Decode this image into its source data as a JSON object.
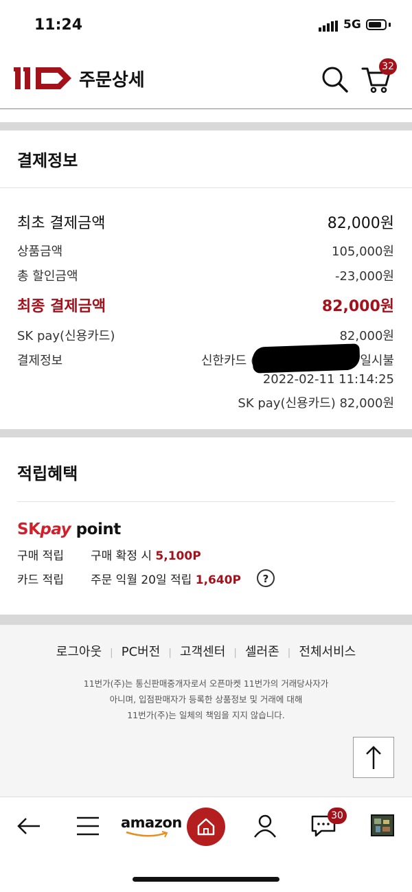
{
  "status": {
    "time": "11:24",
    "network": "5G"
  },
  "header": {
    "title": "주문상세",
    "cart_count": "32"
  },
  "payment": {
    "section_title": "결제정보",
    "initial_label": "최초 결제금액",
    "initial_value": "82,000원",
    "product_label": "상품금액",
    "product_value": "105,000원",
    "discount_label": "총 할인금액",
    "discount_value": "-23,000원",
    "final_label": "최종 결제금액",
    "final_value": "82,000원",
    "method_label": "SK pay(신용카드)",
    "method_value": "82,000원",
    "info_label": "결제정보",
    "card_name": "신한카드 (",
    "installment": "일시불",
    "datetime": "2022-02-11 11:14:25",
    "info_summary": "SK pay(신용카드) 82,000원"
  },
  "rewards": {
    "section_title": "적립혜택",
    "brand_sk": "SK",
    "brand_pay": "pay",
    "brand_point": " point",
    "purchase_label": "구매 적립",
    "purchase_text": "구매 확정 시 ",
    "purchase_points": "5,100P",
    "card_label": "카드 적립",
    "card_text": "주문 익월 20일 적립 ",
    "card_points": "1,640P",
    "help": "?"
  },
  "footer": {
    "links": [
      "로그아웃",
      "PC버전",
      "고객센터",
      "셀러존",
      "전체서비스"
    ],
    "notice_1": "11번가(주)는 통신판매중개자로서 오픈마켓 11번가의 거래당사자가",
    "notice_2": "아니며, 입점판매자가 등록한 상품정보 및 거래에 대해",
    "notice_3": "11번가(주)는 일체의 책임을 지지 않습니다."
  },
  "bottom_nav": {
    "amazon": "amazon",
    "chat_count": "30"
  },
  "colors": {
    "brand": "#a3111b",
    "home": "#b51e1e",
    "band": "#d8d8d8"
  }
}
